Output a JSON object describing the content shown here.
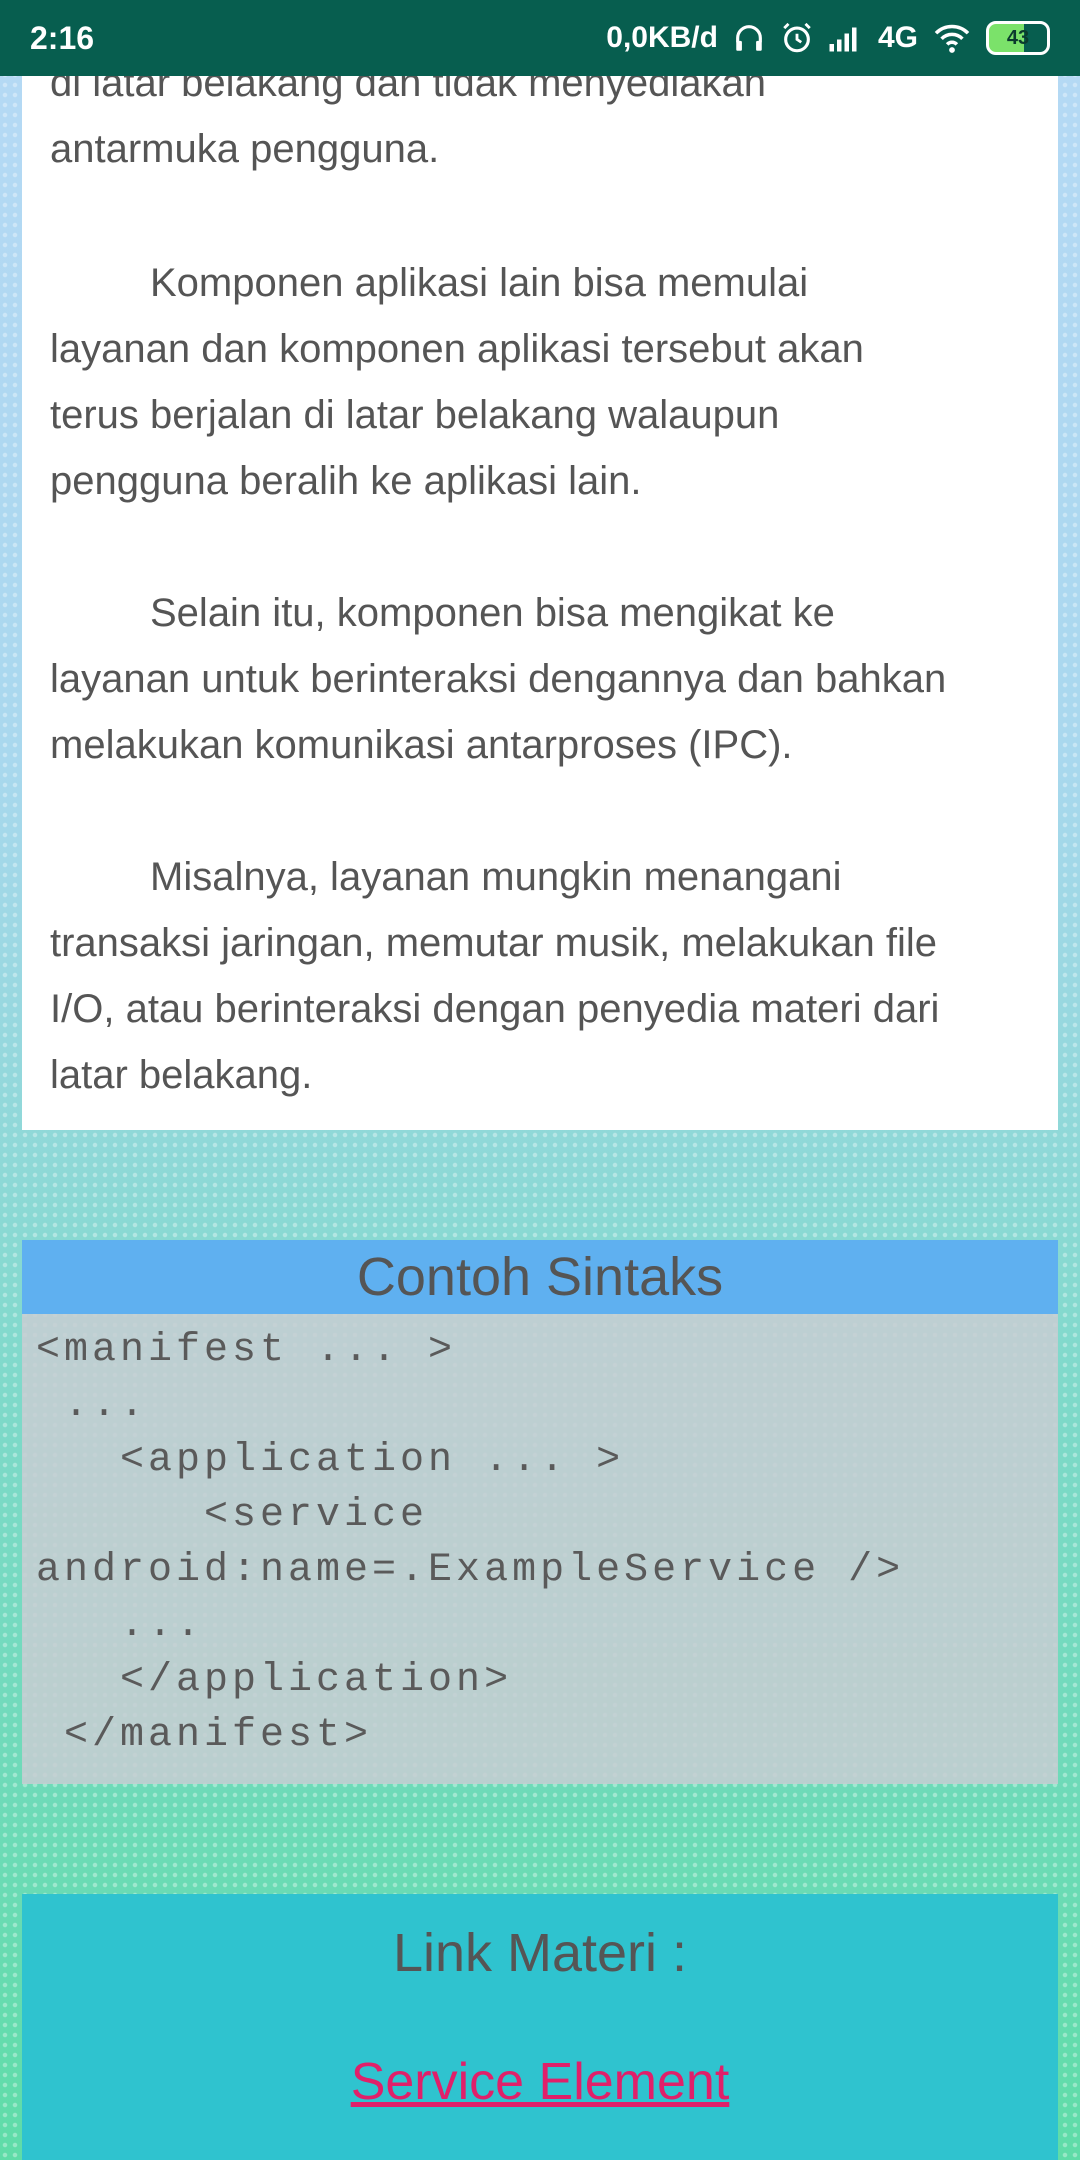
{
  "status_bar": {
    "time": "2:16",
    "network_speed": "0,0KB/d",
    "network_type": "4G",
    "battery": "43",
    "icons": [
      "headphones-icon",
      "alarm-icon",
      "signal-icon",
      "wifi-icon",
      "battery-icon"
    ]
  },
  "article": {
    "partial_line_1": "di latar belakang dan tidak menyediakan",
    "partial_line_2": "antarmuka pengguna.",
    "para_2": [
      "Komponen aplikasi lain bisa memulai",
      "layanan dan komponen aplikasi tersebut akan",
      "terus berjalan di latar belakang walaupun",
      "pengguna beralih ke aplikasi lain."
    ],
    "para_3": [
      "Selain itu, komponen bisa mengikat ke",
      "layanan untuk berinteraksi dengannya dan bahkan",
      "melakukan komunikasi antarproses (IPC)."
    ],
    "para_4": [
      "Misalnya, layanan mungkin menangani",
      "transaksi jaringan, memutar musik, melakukan file",
      "I/O, atau berinteraksi dengan penyedia materi dari",
      "latar belakang."
    ]
  },
  "syntax": {
    "title": "Contoh Sintaks",
    "lines": [
      "<manifest ... >",
      " ...",
      "   <application ... >",
      "      <service",
      "android:name=.ExampleService />",
      "   ...",
      "   </application>",
      " </manifest>"
    ]
  },
  "links": {
    "title": "Link Materi :",
    "link_label": "Service Element"
  },
  "colors": {
    "status_bar": "#075e4f",
    "syntax_header": "#5fb0f0",
    "link_box": "#2fc3cf",
    "link_text": "#e0206a"
  }
}
